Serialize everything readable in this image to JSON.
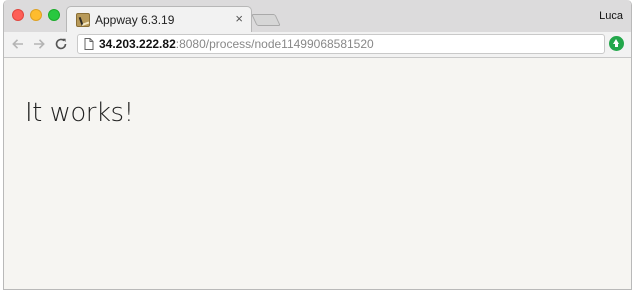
{
  "browser": {
    "tab": {
      "title": "Appway 6.3.19",
      "close_symbol": "×",
      "favicon": "appway-favicon"
    },
    "profile_name": "Luca",
    "url": {
      "host": "34.203.222.82",
      "rest": ":8080/process/node11499068581520"
    },
    "icons": {
      "back": "arrow-left-icon",
      "forward": "arrow-right-icon",
      "reload": "reload-icon",
      "page": "page-icon",
      "extension": "upload-arrow-icon"
    },
    "colors": {
      "close": "#fe5f57",
      "minimize": "#febc2e",
      "maximize": "#28c840",
      "extension": "#23a74b",
      "page_background": "#f6f5f2"
    }
  },
  "page": {
    "headline": "It works!"
  }
}
